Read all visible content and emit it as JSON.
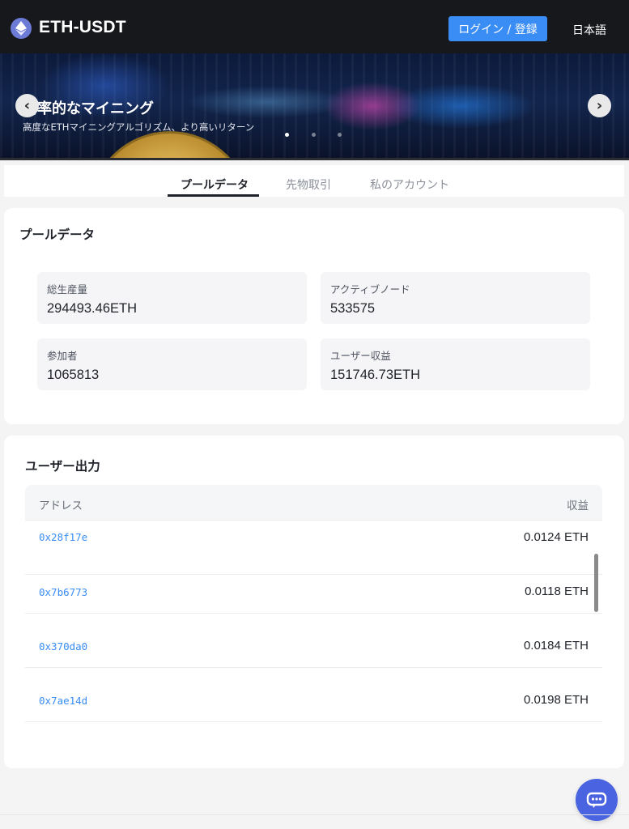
{
  "header": {
    "brand": "ETH-USDT",
    "login_label": "ログイン / 登録",
    "language": "日本語"
  },
  "banner": {
    "title": "効率的なマイニング",
    "subtitle": "高度なETHマイニングアルゴリズム、より高いリターン",
    "slide_count": 3,
    "active_slide": 1
  },
  "tabs": [
    {
      "label": "プールデータ",
      "active": true
    },
    {
      "label": "先物取引",
      "active": false
    },
    {
      "label": "私のアカウント",
      "active": false
    }
  ],
  "pool": {
    "title": "プールデータ",
    "stats": [
      {
        "label": "総生産量",
        "value": "294493.46ETH"
      },
      {
        "label": "アクティブノード",
        "value": "533575"
      },
      {
        "label": "参加者",
        "value": "1065813"
      },
      {
        "label": "ユーザー収益",
        "value": "151746.73ETH"
      }
    ]
  },
  "output": {
    "title": "ユーザー出力",
    "columns": {
      "address": "アドレス",
      "profit": "収益"
    },
    "rows": [
      {
        "address": "0x28f17e",
        "amount": "0.0124 ETH"
      },
      {
        "address": "0x7b6773",
        "amount": "0.0118 ETH"
      },
      {
        "address": "0x370da0",
        "amount": "0.0184 ETH"
      },
      {
        "address": "0x7ae14d",
        "amount": "0.0198 ETH"
      }
    ]
  },
  "colors": {
    "header_bg": "#17181c",
    "accent": "#3a8df5",
    "chat_button": "#4a63e0"
  },
  "icons": {
    "logo": "ethereum-icon",
    "prev": "chevron-left-icon",
    "next": "chevron-right-icon",
    "chat": "chat-bubble-icon"
  }
}
